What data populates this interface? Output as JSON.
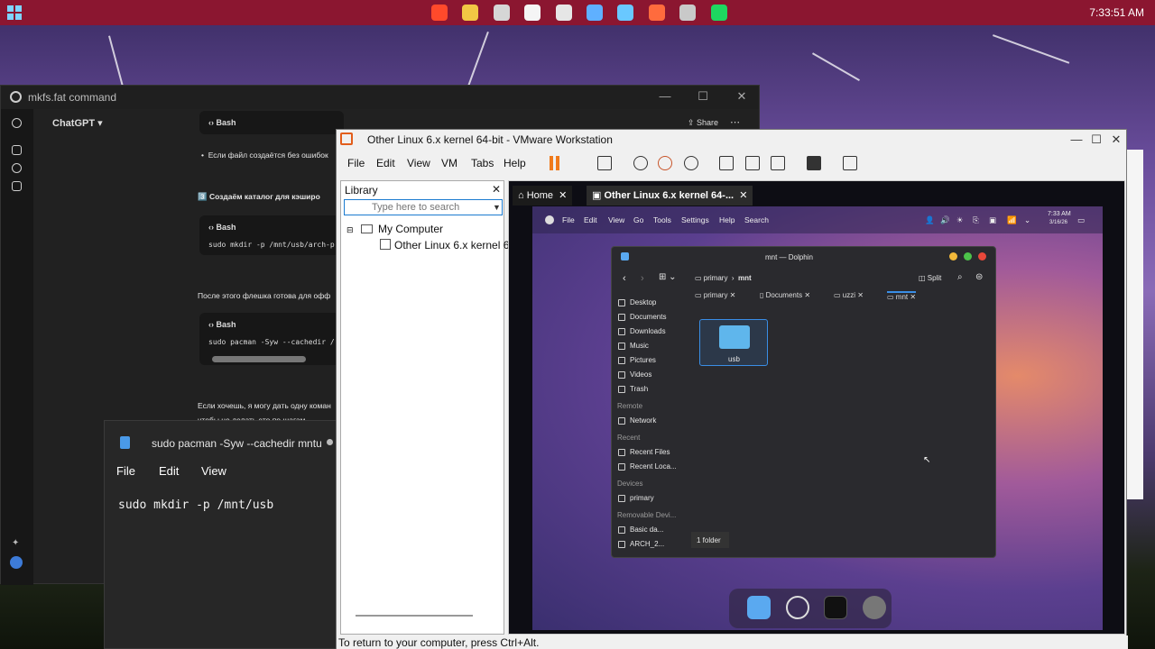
{
  "taskbar": {
    "clock": "7:33:51 AM",
    "apps": [
      {
        "icon": "search-icon",
        "color": "#ff4a2b"
      },
      {
        "icon": "file-explorer-icon",
        "color": "#f2c744"
      },
      {
        "icon": "obs-icon",
        "color": "#d6d6d6"
      },
      {
        "icon": "chatgpt-icon",
        "color": "#f5f5f5"
      },
      {
        "icon": "tools-icon",
        "color": "#e6e6e6"
      },
      {
        "icon": "notepad-icon",
        "color": "#5fb0ff"
      },
      {
        "icon": "vscode-icon",
        "color": "#69c8ff"
      },
      {
        "icon": "vmware-icon",
        "color": "#ff6b3d"
      },
      {
        "icon": "steam-icon",
        "color": "#c9c9c9"
      },
      {
        "icon": "spotify-icon",
        "color": "#1ed760"
      }
    ]
  },
  "chatgpt": {
    "window_title": "mkfs.fat command",
    "model_selector": "ChatGPT ▾",
    "share_label": "Share",
    "code1": {
      "lang": "Bash"
    },
    "bullet_text": "Если файл создаётся без ошибок",
    "step_heading": "3️⃣ Создаём каталог для кэширо",
    "code2": {
      "lang": "Bash",
      "line": "sudo mkdir -p /mnt/usb/arch-p"
    },
    "after_text": "После этого флешка готова для офф",
    "code3": {
      "lang": "Bash",
      "line": "sudo pacman -Syw --cachedir /"
    },
    "tail_text_1": "Если хочешь, я могу дать одну коман",
    "tail_text_2": "чтобы не делать это по шагам"
  },
  "notepad": {
    "tab_title": "sudo pacman -Syw --cachedir mntu",
    "menu": [
      "File",
      "Edit",
      "View"
    ],
    "content": "sudo mkdir -p /mnt/usb"
  },
  "vmware": {
    "title": "Other Linux 6.x kernel 64-bit - VMware Workstation",
    "menu": [
      "File",
      "Edit",
      "View",
      "VM",
      "Tabs",
      "Help"
    ],
    "library": {
      "heading": "Library",
      "search_placeholder": "Type here to search",
      "tree_root": "My Computer",
      "tree_child": "Other Linux 6.x kernel 64"
    },
    "tabs": [
      {
        "label": "Home"
      },
      {
        "label": "Other Linux 6.x kernel 64-..."
      }
    ],
    "status_text": "To return to your computer, press Ctrl+Alt."
  },
  "guest": {
    "menubar": [
      "File",
      "Edit",
      "View",
      "Go",
      "Tools",
      "Settings",
      "Help",
      "Search"
    ],
    "clock_time": "7:33 AM",
    "clock_date": "3/16/26",
    "dolphin": {
      "title": "mnt — Dolphin",
      "breadcrumb_root": "primary",
      "breadcrumb_current": "mnt",
      "split_label": "Split",
      "places": [
        "Desktop",
        "Documents",
        "Downloads",
        "Music",
        "Pictures",
        "Videos",
        "Trash"
      ],
      "remote_heading": "Remote",
      "remote_items": [
        "Network"
      ],
      "recent_heading": "Recent",
      "recent_items": [
        "Recent Files",
        "Recent Loca..."
      ],
      "devices_heading": "Devices",
      "devices_items": [
        "primary"
      ],
      "removable_heading": "Removable Devi...",
      "removable_items": [
        "Basic da...",
        "ARCH_2..."
      ],
      "tabs": [
        "primary",
        "Documents",
        "uzzi",
        "mnt"
      ],
      "folder_name": "usb",
      "status": "1 folder"
    }
  }
}
